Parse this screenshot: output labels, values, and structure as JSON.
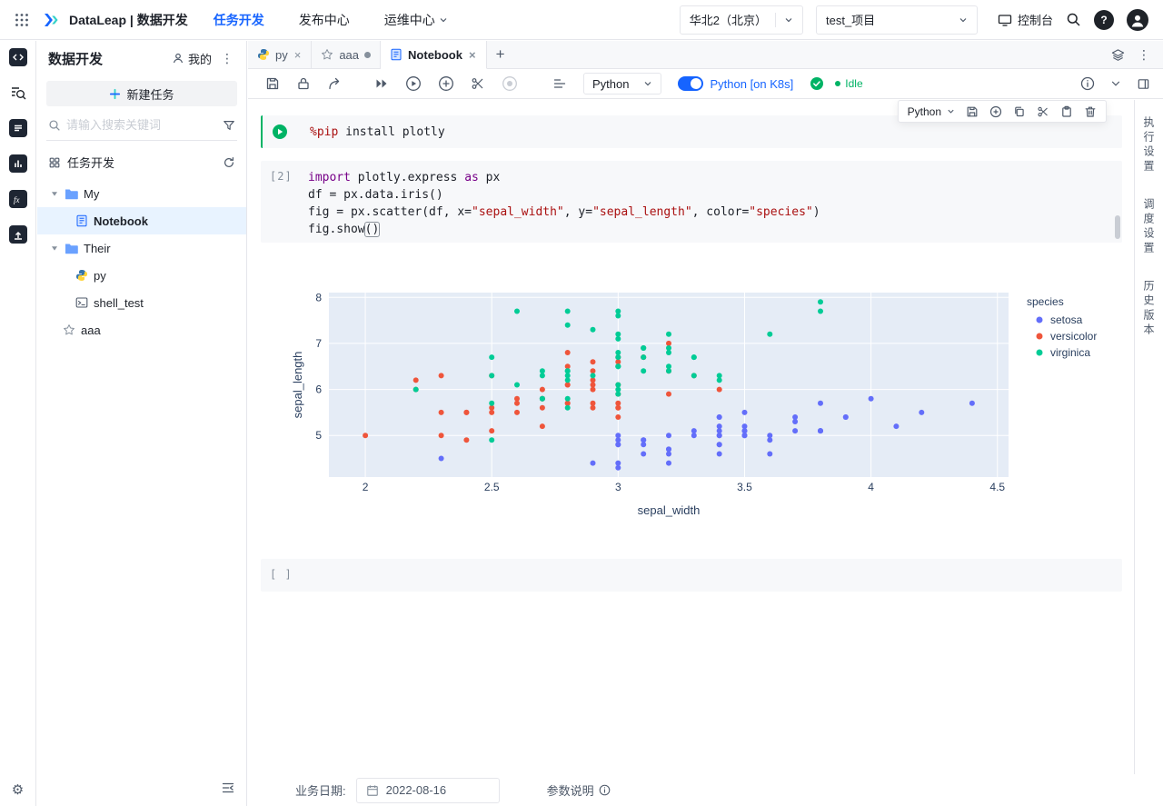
{
  "colors": {
    "accent": "#1664ff",
    "success": "#00b365"
  },
  "topbar": {
    "product_title": "DataLeap | 数据开发",
    "nav": [
      {
        "label": "任务开发",
        "active": true,
        "caret": false
      },
      {
        "label": "发布中心",
        "active": false,
        "caret": false
      },
      {
        "label": "运维中心",
        "active": false,
        "caret": true
      }
    ],
    "region": "华北2（北京）",
    "project": "test_项目",
    "console_label": "控制台"
  },
  "sidebar": {
    "title": "数据开发",
    "mine_label": "我的",
    "new_task_label": "新建任务",
    "search_placeholder": "请输入搜索关键词",
    "section_label": "任务开发",
    "tree": [
      {
        "label": "My",
        "type": "folder",
        "expanded": true,
        "selected": false
      },
      {
        "label": "Notebook",
        "type": "notebook",
        "expanded": false,
        "selected": true
      },
      {
        "label": "Their",
        "type": "folder",
        "expanded": true,
        "selected": false
      },
      {
        "label": "py",
        "type": "python",
        "expanded": false,
        "selected": false
      },
      {
        "label": "shell_test",
        "type": "shell",
        "expanded": false,
        "selected": false
      },
      {
        "label": "aaa",
        "type": "star",
        "expanded": false,
        "selected": false
      }
    ]
  },
  "editor": {
    "tabs": [
      {
        "label": "py",
        "icon": "python",
        "active": false,
        "close": true,
        "dirty": false
      },
      {
        "label": "aaa",
        "icon": "star",
        "active": false,
        "close": false,
        "dirty": true
      },
      {
        "label": "Notebook",
        "icon": "notebook",
        "active": true,
        "close": true,
        "dirty": false
      }
    ],
    "toolbar": {
      "kernel": "Python",
      "runtime_label": "Python [on K8s]",
      "status": "Idle"
    },
    "cell_toolbar_kernel": "Python",
    "right_tabs": [
      "执行设置",
      "调度设置",
      "历史版本"
    ],
    "cells": [
      {
        "gutter": "run",
        "scrollbar": false,
        "lines": [
          [
            {
              "t": "magic",
              "v": "%pip"
            },
            {
              "t": "",
              "v": " install plotly"
            }
          ]
        ]
      },
      {
        "gutter": "[2]",
        "scrollbar": true,
        "lines": [
          [
            {
              "t": "kw",
              "v": "import"
            },
            {
              "t": "",
              "v": " plotly.express "
            },
            {
              "t": "kw",
              "v": "as"
            },
            {
              "t": "",
              "v": " px"
            }
          ],
          [
            {
              "t": "",
              "v": "df = px.data.iris()"
            }
          ],
          [
            {
              "t": "",
              "v": "fig = px.scatter(df, x="
            },
            {
              "t": "str",
              "v": "\"sepal_width\""
            },
            {
              "t": "",
              "v": ", y="
            },
            {
              "t": "str",
              "v": "\"sepal_length\""
            },
            {
              "t": "",
              "v": ", color="
            },
            {
              "t": "str",
              "v": "\"species\""
            },
            {
              "t": "",
              "v": ")"
            }
          ],
          [
            {
              "t": "",
              "v": "fig.show"
            },
            {
              "t": "cursor",
              "v": "()"
            }
          ]
        ]
      },
      {
        "gutter": "[ ]",
        "scrollbar": false,
        "lines": []
      }
    ],
    "bottom": {
      "date_label": "业务日期:",
      "date_value": "2022-08-16",
      "params_label": "参数说明"
    }
  },
  "chart_data": {
    "type": "scatter",
    "title": "",
    "xlabel": "sepal_width",
    "ylabel": "sepal_length",
    "xlim": [
      1.856,
      4.544
    ],
    "ylim": [
      4.096,
      8.104
    ],
    "xticks": [
      2,
      2.5,
      3,
      3.5,
      4,
      4.5
    ],
    "yticks": [
      5,
      6,
      7,
      8
    ],
    "legend_title": "species",
    "plot_bg": "#e5ecf6",
    "grid": true,
    "legend_position": "right",
    "series": [
      {
        "name": "setosa",
        "color": "#636efa",
        "x": [
          3.5,
          3.0,
          3.2,
          3.1,
          3.6,
          3.9,
          3.4,
          3.4,
          2.9,
          3.1,
          3.7,
          3.4,
          3.0,
          3.0,
          4.0,
          4.4,
          3.9,
          3.5,
          3.8,
          3.8,
          3.4,
          3.7,
          3.6,
          3.3,
          3.4,
          3.0,
          3.4,
          3.5,
          3.4,
          3.2,
          3.1,
          3.4,
          4.1,
          4.2,
          3.1,
          3.2,
          3.5,
          3.6,
          3.0,
          3.4,
          3.5,
          2.3,
          3.2,
          3.5,
          3.8,
          3.0,
          3.8,
          3.2,
          3.7,
          3.3
        ],
        "y": [
          5.1,
          4.9,
          4.7,
          4.6,
          5.0,
          5.4,
          4.6,
          5.0,
          4.4,
          4.9,
          5.4,
          4.8,
          4.8,
          4.3,
          5.8,
          5.7,
          5.4,
          5.1,
          5.7,
          5.1,
          5.4,
          5.1,
          4.6,
          5.1,
          4.8,
          5.0,
          5.0,
          5.2,
          5.2,
          4.7,
          4.8,
          5.4,
          5.2,
          5.5,
          4.9,
          5.0,
          5.5,
          4.9,
          4.4,
          5.1,
          5.0,
          4.5,
          4.4,
          5.0,
          5.1,
          4.8,
          5.1,
          4.6,
          5.3,
          5.0
        ]
      },
      {
        "name": "versicolor",
        "color": "#EF553B",
        "x": [
          3.2,
          3.2,
          3.1,
          2.3,
          2.8,
          2.8,
          3.3,
          2.4,
          2.9,
          2.7,
          2.0,
          3.0,
          2.2,
          2.9,
          2.9,
          3.1,
          3.0,
          2.7,
          2.2,
          2.5,
          3.2,
          2.8,
          2.5,
          2.8,
          2.9,
          3.0,
          2.8,
          3.0,
          2.9,
          2.6,
          2.4,
          2.4,
          2.7,
          2.7,
          3.0,
          3.4,
          3.1,
          2.3,
          3.0,
          2.5,
          2.6,
          3.0,
          2.6,
          2.3,
          2.7,
          3.0,
          2.9,
          2.9,
          2.5,
          2.8
        ],
        "y": [
          7.0,
          6.4,
          6.9,
          5.5,
          6.5,
          5.7,
          6.3,
          4.9,
          6.6,
          5.2,
          5.0,
          5.9,
          6.0,
          6.1,
          5.6,
          6.7,
          5.6,
          5.8,
          6.2,
          5.6,
          5.9,
          6.1,
          6.3,
          6.1,
          6.4,
          6.6,
          6.8,
          6.7,
          6.0,
          5.7,
          5.5,
          5.5,
          5.8,
          6.0,
          5.4,
          6.0,
          6.7,
          6.3,
          5.6,
          5.5,
          5.5,
          6.1,
          5.8,
          5.0,
          5.6,
          5.7,
          5.7,
          6.2,
          5.1,
          5.7
        ]
      },
      {
        "name": "virginica",
        "color": "#00cc96",
        "x": [
          3.3,
          2.7,
          3.0,
          2.9,
          3.0,
          3.0,
          2.5,
          2.9,
          2.5,
          3.6,
          3.2,
          2.7,
          3.0,
          2.5,
          2.8,
          3.2,
          3.0,
          3.8,
          2.6,
          2.2,
          3.2,
          2.8,
          2.8,
          2.7,
          3.3,
          3.2,
          2.8,
          3.0,
          2.8,
          3.0,
          2.8,
          3.8,
          2.8,
          2.8,
          2.6,
          3.0,
          3.4,
          3.1,
          3.0,
          3.1,
          3.1,
          3.1,
          2.7,
          3.2,
          3.3,
          3.0,
          2.5,
          3.0,
          3.4,
          3.0
        ],
        "y": [
          6.3,
          5.8,
          7.1,
          6.3,
          6.5,
          7.6,
          4.9,
          7.3,
          6.7,
          7.2,
          6.5,
          6.4,
          6.8,
          5.7,
          5.8,
          6.4,
          6.5,
          7.7,
          7.7,
          6.0,
          6.9,
          5.6,
          7.7,
          6.3,
          6.7,
          7.2,
          6.2,
          6.1,
          6.4,
          7.2,
          7.4,
          7.9,
          6.4,
          6.3,
          6.1,
          7.7,
          6.3,
          6.4,
          6.0,
          6.9,
          6.7,
          6.9,
          5.8,
          6.8,
          6.7,
          6.7,
          6.3,
          6.5,
          6.2,
          5.9
        ]
      }
    ]
  }
}
